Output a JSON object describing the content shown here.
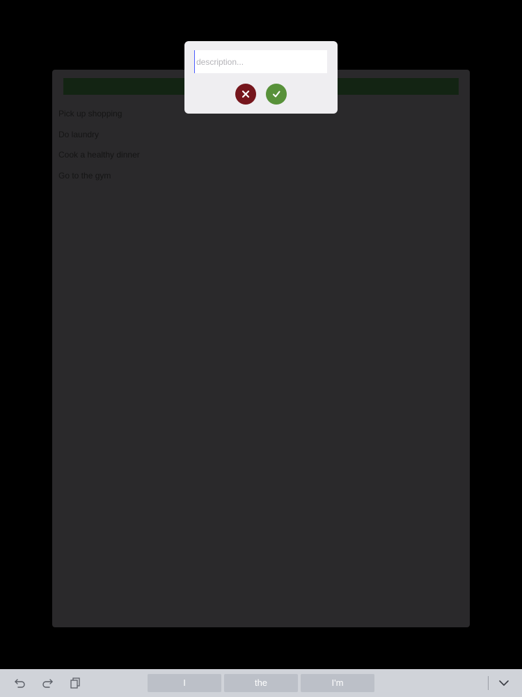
{
  "tasks": [
    {
      "label": "Pick up shopping"
    },
    {
      "label": "Do laundry"
    },
    {
      "label": "Cook a healthy dinner"
    },
    {
      "label": "Go to the gym"
    }
  ],
  "dialog": {
    "input_value": "",
    "input_placeholder": "description..."
  },
  "keyboard": {
    "suggestions": [
      "I",
      "the",
      "I'm"
    ]
  },
  "colors": {
    "cancel": "#76161d",
    "confirm": "#58913a",
    "panel": "#2a292b",
    "header_bar": "#132413"
  }
}
